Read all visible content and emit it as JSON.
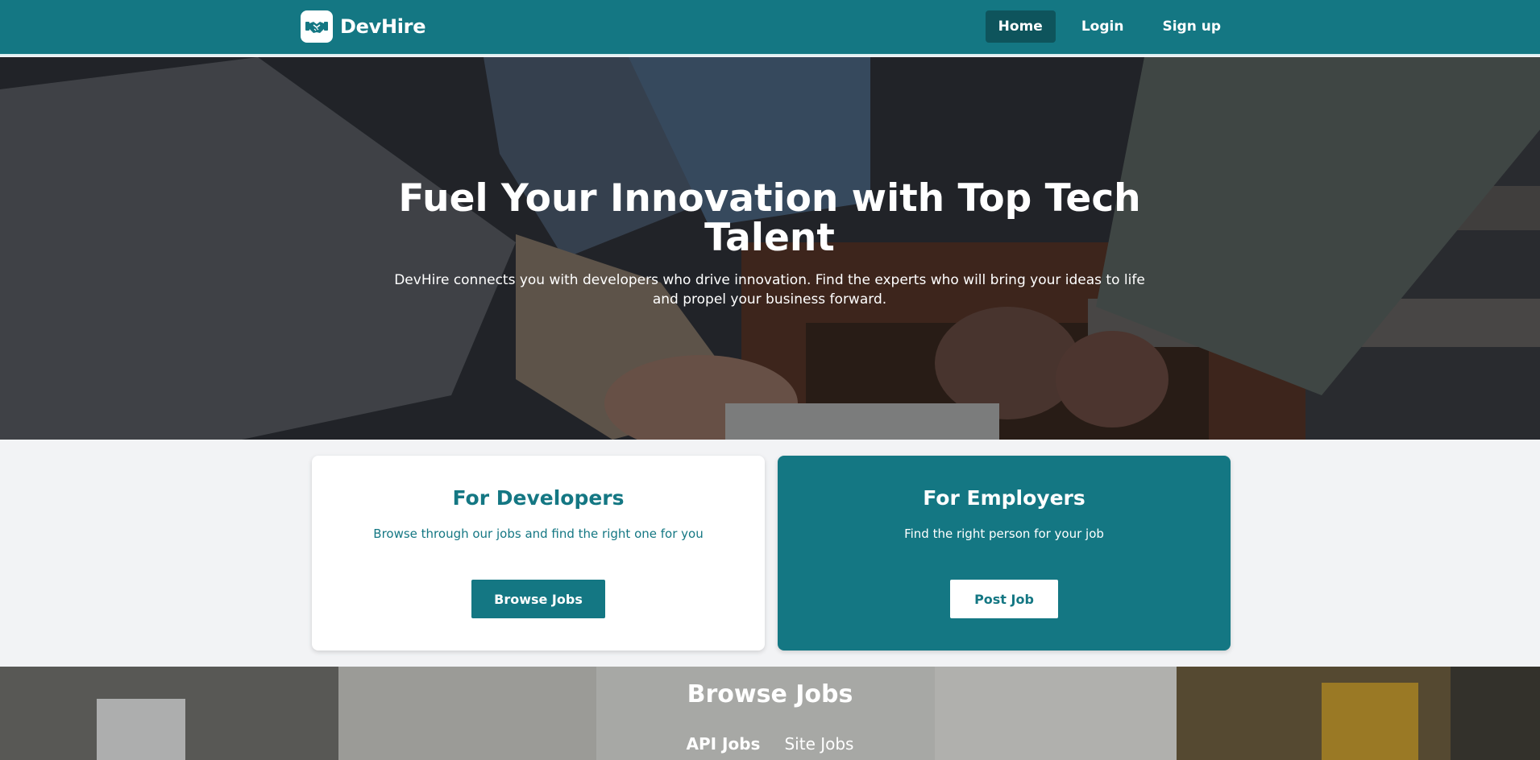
{
  "nav": {
    "brand": "DevHire",
    "links": [
      {
        "label": "Home",
        "active": true
      },
      {
        "label": "Login",
        "active": false
      },
      {
        "label": "Sign up",
        "active": false
      }
    ]
  },
  "hero": {
    "title": "Fuel Your Innovation with Top Tech Talent",
    "subtitle": "DevHire connects you with developers who drive innovation. Find the experts who will bring your ideas to life and propel your business forward."
  },
  "cards": {
    "developers": {
      "title": "For Developers",
      "text": "Browse through our jobs and find the right one for you",
      "button": "Browse Jobs"
    },
    "employers": {
      "title": "For Employers",
      "text": "Find the right person for your job",
      "button": "Post Job"
    }
  },
  "browse": {
    "title": "Browse Jobs",
    "tabs": [
      "API Jobs",
      "Site Jobs"
    ]
  },
  "colors": {
    "primary": "#147783",
    "primary_dark": "#0e545c",
    "background": "#f2f3f5"
  },
  "icons": {
    "brand_logo": "handshake-icon"
  }
}
